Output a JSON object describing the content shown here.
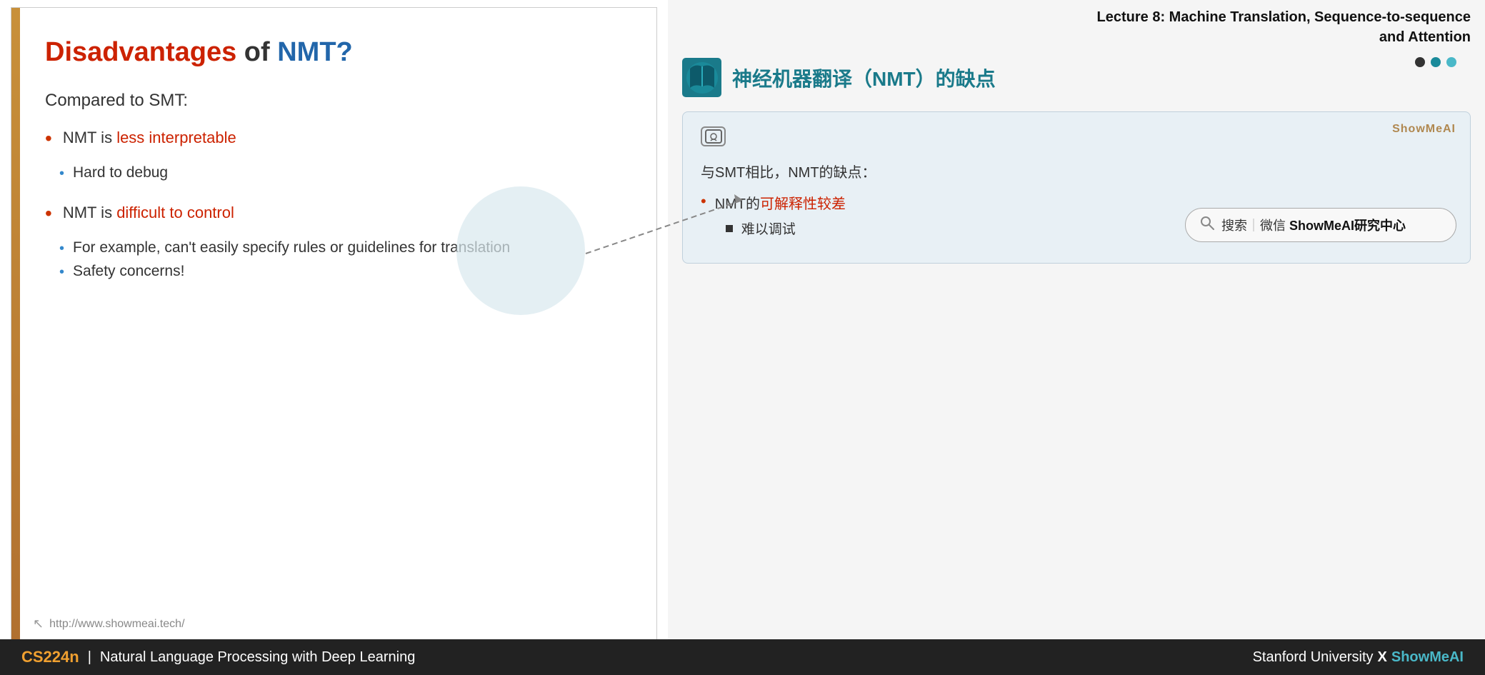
{
  "slide": {
    "title": {
      "part1": "Disadvantages",
      "part2": "of",
      "part3": "NMT?"
    },
    "subtitle": "Compared to SMT:",
    "bullets": [
      {
        "main_text_prefix": "NMT is ",
        "main_text_highlight": "less interpretable",
        "sub_bullets": [
          "Hard to debug"
        ]
      },
      {
        "main_text_prefix": "NMT is ",
        "main_text_highlight": "difficult to control",
        "sub_bullets": [
          "For example, can’t easily specify rules or guidelines for translation",
          "Safety concerns!"
        ]
      }
    ],
    "footer_url": "http://www.showmeai.tech/"
  },
  "right": {
    "lecture_title_line1": "Lecture 8:  Machine Translation, Sequence-to-sequence",
    "lecture_title_line2": "and Attention",
    "chinese_title": "神经机器翻译（NMT）的缺点",
    "annotation": {
      "badge": "↺①",
      "watermark": "ShowMeAI",
      "main_text": "与SMT相比，NMT的缺点：",
      "bullet_prefix": "NMT的",
      "bullet_highlight": "可解释性较差",
      "sub_bullet": "难以调试"
    },
    "search_box": {
      "icon": "⌕",
      "text": "搜索｜微信 ShowMeAI研究中心"
    }
  },
  "bottom_bar": {
    "cs_label": "CS224n",
    "separator": "|",
    "description": "Natural Language Processing with Deep Learning",
    "right_text_prefix": "Stanford University",
    "x_symbol": "X",
    "showmeai": "ShowMeAI"
  },
  "colors": {
    "red_highlight": "#cc2200",
    "blue_title": "#2266aa",
    "teal": "#1a7a8a",
    "orange_bar": "#c8903a",
    "bottom_bg": "#222222",
    "bottom_orange": "#f0a030",
    "bottom_teal": "#4ab8c8"
  }
}
